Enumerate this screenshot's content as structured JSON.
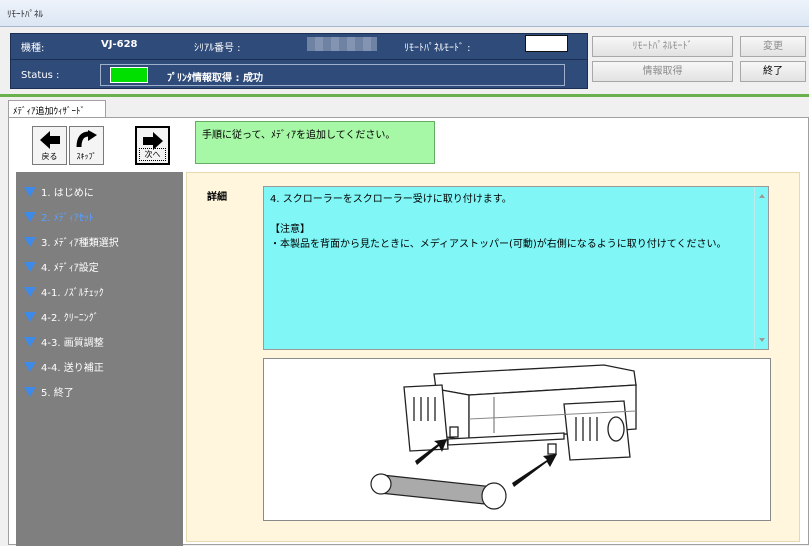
{
  "window": {
    "title": "ﾘﾓｰﾄﾊﾟﾈﾙ"
  },
  "status_panel": {
    "model_label": "機種:",
    "model_value": "VJ-628",
    "serial_label": "ｼﾘｱﾙ番号 :",
    "remote_mode_label": "ﾘﾓｰﾄﾊﾟﾈﾙﾓｰﾄﾞ :",
    "status_label": "Status :",
    "status_message": "ﾌﾟﾘﾝﾀ情報取得 : 成功",
    "status_color": "#00e000"
  },
  "buttons": {
    "remote_panel_mode": "ﾘﾓｰﾄﾊﾟﾈﾙﾓｰﾄﾞ",
    "change": "変更",
    "get_info": "情報取得",
    "exit": "終了"
  },
  "tab": {
    "label": "ﾒﾃﾞｨｱ追加ｳｨｻﾞｰﾄﾞ"
  },
  "nav": {
    "back": "戻る",
    "skip": "ｽｷｯﾌﾟ",
    "next": "次へ"
  },
  "instruction": "手順に従って、ﾒﾃﾞｨｱを追加してください。",
  "steps": [
    {
      "label": "1. はじめに",
      "active": false
    },
    {
      "label": "2. ﾒﾃﾞｨｱｾｯﾄ",
      "active": true
    },
    {
      "label": "3. ﾒﾃﾞｨｱ種類選択",
      "active": false
    },
    {
      "label": "4. ﾒﾃﾞｨｱ設定",
      "active": false
    },
    {
      "label": "4-1. ﾉｽﾞﾙﾁｪｯｸ",
      "active": false
    },
    {
      "label": "4-2. ｸﾘｰﾆﾝｸﾞ",
      "active": false
    },
    {
      "label": "4-3. 画質調整",
      "active": false
    },
    {
      "label": "4-4. 送り補正",
      "active": false
    },
    {
      "label": "5. 終了",
      "active": false
    }
  ],
  "detail": {
    "label": "詳細",
    "lines": [
      "4. スクローラーをスクローラー受けに取り付けます。",
      "",
      "【注意】",
      "・本製品を背面から見たときに、メディアストッパー(可動)が右側になるように取り付けてください。"
    ]
  },
  "colors": {
    "status_panel_bg": "#2e4b7a",
    "instruction_bg": "#a6f7a6",
    "detail_text_bg": "#80f6f6",
    "steps_bg": "#7f7f7f",
    "active_step": "#5aa0ff"
  }
}
